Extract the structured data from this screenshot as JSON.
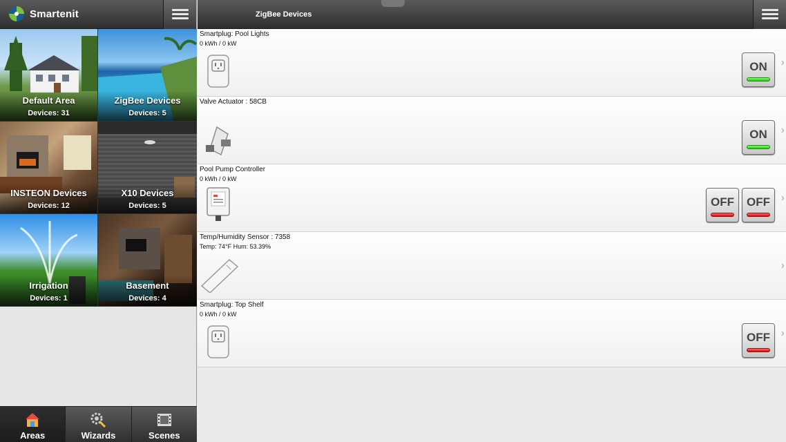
{
  "app": {
    "title": "Smartenit"
  },
  "areas": [
    {
      "name": "Default Area",
      "count": "Devices: 31"
    },
    {
      "name": "ZigBee Devices",
      "count": "Devices: 5"
    },
    {
      "name": "INSTEON Devices",
      "count": "Devices: 12"
    },
    {
      "name": "X10 Devices",
      "count": "Devices: 5"
    },
    {
      "name": "Irrigation",
      "count": "Devices: 1"
    },
    {
      "name": "Basement",
      "count": "Devices: 4"
    }
  ],
  "nav": [
    {
      "label": "Areas",
      "icon": "house-icon",
      "active": true
    },
    {
      "label": "Wizards",
      "icon": "gear-wand-icon",
      "active": false
    },
    {
      "label": "Scenes",
      "icon": "film-icon",
      "active": false
    }
  ],
  "panel": {
    "title": "ZigBee Devices"
  },
  "devices": [
    {
      "name": "Smartplug: Pool Lights",
      "status": "0 kWh / 0 kW",
      "icon": "smartplug-icon",
      "toggles": [
        "ON"
      ]
    },
    {
      "name": "Valve Actuator : 58CB",
      "status": "",
      "icon": "valve-actuator-icon",
      "toggles": [
        "ON"
      ]
    },
    {
      "name": "Pool Pump Controller",
      "status": "0 kWh / 0 kW",
      "icon": "pump-controller-icon",
      "toggles": [
        "OFF",
        "OFF"
      ]
    },
    {
      "name": "Temp/Humidity Sensor : 7358",
      "status": "Temp: 74°F Hum: 53.39%",
      "icon": "sensor-icon",
      "toggles": []
    },
    {
      "name": "Smartplug: Top Shelf",
      "status": "0 kWh / 0 kW",
      "icon": "smartplug-icon",
      "toggles": [
        "OFF"
      ]
    }
  ],
  "colors": {
    "on": "#28c21a",
    "off": "#d10c0c",
    "topbar": "#3a3a3a"
  }
}
